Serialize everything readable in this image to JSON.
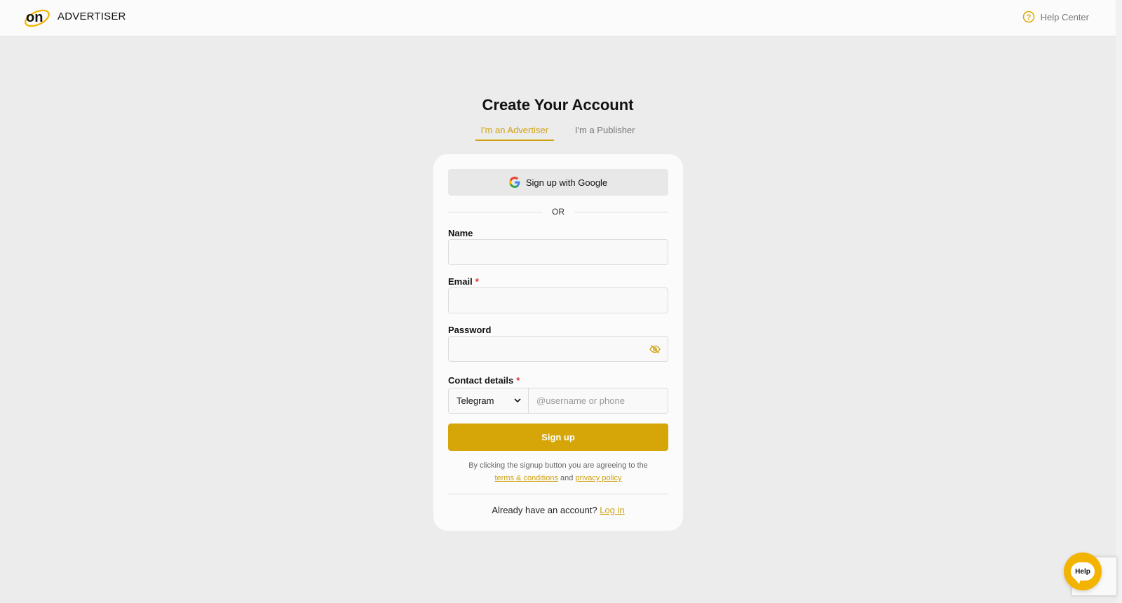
{
  "header": {
    "brand": "ADVERTISER",
    "logo_text": "on",
    "help_center": "Help Center"
  },
  "page": {
    "title": "Create Your Account",
    "tabs": [
      {
        "label": "I'm an Advertiser",
        "active": true
      },
      {
        "label": "I'm a Publisher",
        "active": false
      }
    ]
  },
  "form": {
    "google_button": "Sign up with Google",
    "or_text": "OR",
    "name_label": "Name",
    "email_label": "Email",
    "password_label": "Password",
    "contact_label": "Contact details",
    "required_mark": "*",
    "contact_method": "Telegram",
    "contact_placeholder": "@username or phone",
    "signup_button": "Sign up",
    "terms_prefix": "By clicking the signup button you are agreeing to the",
    "terms_link": "terms & conditions",
    "terms_and": "and",
    "privacy_link": "privacy policy",
    "login_prompt": "Already have an account?",
    "login_link": "Log in"
  },
  "widgets": {
    "help_bubble": "Help"
  },
  "colors": {
    "accent": "#d6a507",
    "accent_text": "#cfa110",
    "required": "#e03030",
    "background": "#ececec"
  }
}
